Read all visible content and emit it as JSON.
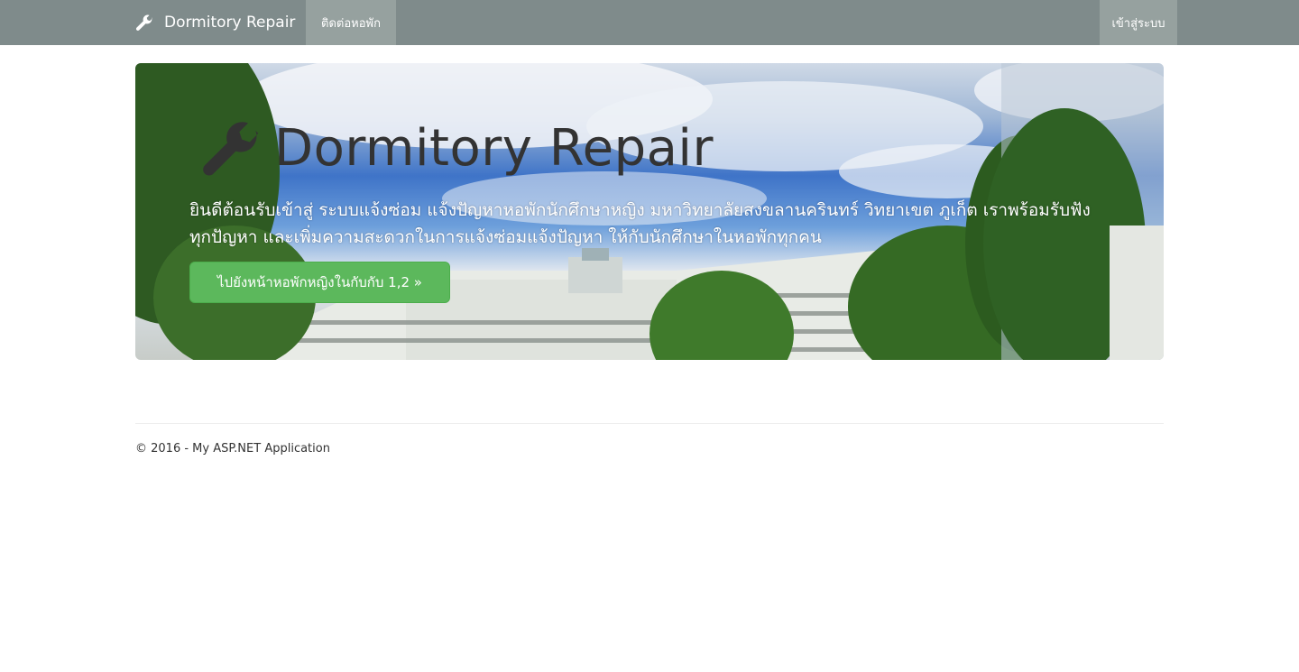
{
  "navbar": {
    "brand_label": "Dormitory Repair",
    "brand_icon": "wrench-icon",
    "links": [
      {
        "label": "ติดต่อหอพัก"
      }
    ],
    "login_label": "เข้าสู่ระบบ",
    "background_color": "#7f8b8b",
    "active_link_color": "#96a19f"
  },
  "hero": {
    "title": "Dormitory Repair",
    "title_icon": "wrench-icon",
    "lead": "ยินดีต้อนรับเข้าสู่ ระบบแจ้งซ่อม แจ้งปัญหาหอพักนักศึกษาหญิง มหาวิทยาลัยสงขลานครินทร์ วิทยาเขต ภูเก็ต เราพร้อมรับฟังทุกปัญหา และเพิ่มความสะดวกในการแจ้งซ่อมแจ้งปัญหา ให้กับนักศึกษาในหอพักทุกคน",
    "button_label": "ไปยังหน้าหอพักหญิงในกับกับ 1,2 »",
    "button_color": "#5cb85c"
  },
  "footer": {
    "text": "© 2016 - My ASP.NET Application"
  }
}
